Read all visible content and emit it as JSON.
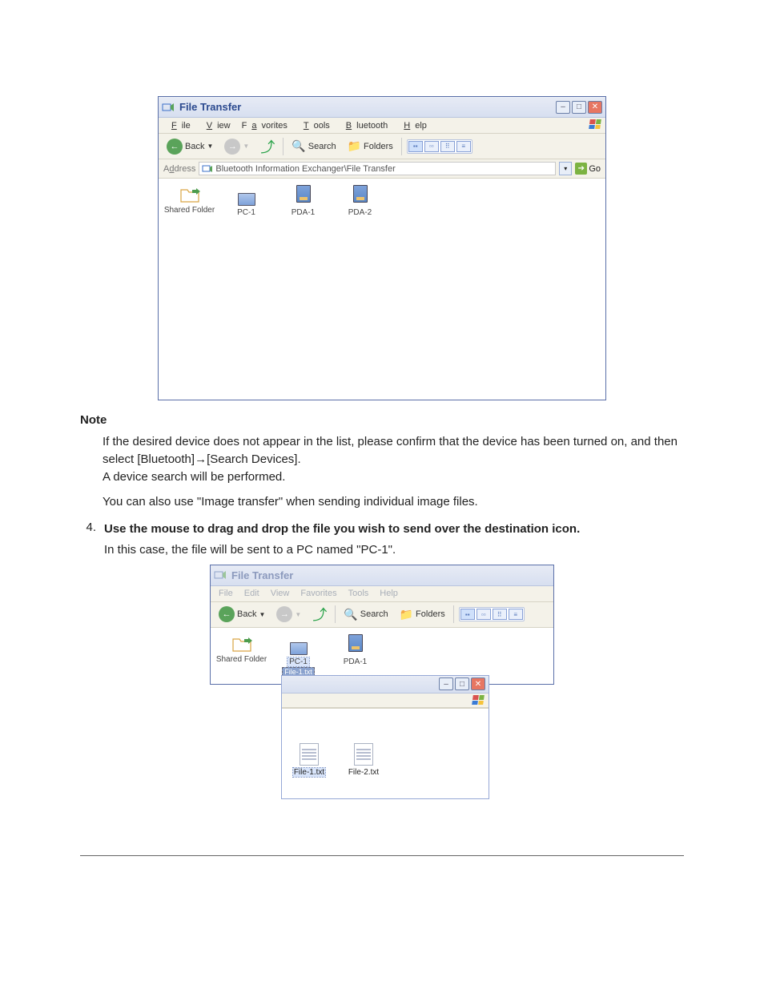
{
  "window1": {
    "title": "File Transfer",
    "menu": [
      "File",
      "View",
      "Favorites",
      "Tools",
      "Bluetooth",
      "Help"
    ],
    "menu_keys": [
      "F",
      "V",
      "a",
      "T",
      "B",
      "H"
    ],
    "toolbar": {
      "back": "Back",
      "search": "Search",
      "folders": "Folders"
    },
    "address": {
      "label": "Address",
      "value": "Bluetooth Information Exchanger\\File Transfer",
      "go": "Go"
    },
    "items": [
      "Shared Folder",
      "PC-1",
      "PDA-1",
      "PDA-2"
    ]
  },
  "note": {
    "heading": "Note",
    "p1": "If the desired device does not appear in the list, please confirm that the device has been turned on, and then select [Bluetooth]→[Search Devices].",
    "p2": "A device search will be performed.",
    "p3": "You can also use \"Image transfer\" when sending individual image files."
  },
  "step4": {
    "num": "4.",
    "title": "Use the mouse to drag and drop the file you wish to send over the destination icon.",
    "desc": "In this case, the file will be sent to a PC named \"PC-1\"."
  },
  "window2": {
    "title": "File Transfer",
    "menu": [
      "File",
      "Edit",
      "View",
      "Favorites",
      "Tools",
      "Help"
    ],
    "toolbar": {
      "back": "Back",
      "search": "Search",
      "folders": "Folders"
    },
    "items": [
      "Shared Folder",
      "PC-1",
      "PDA-1"
    ],
    "drag_label": "File-1.txt"
  },
  "window2sub": {
    "files": [
      "File-1.txt",
      "File-2.txt"
    ]
  }
}
